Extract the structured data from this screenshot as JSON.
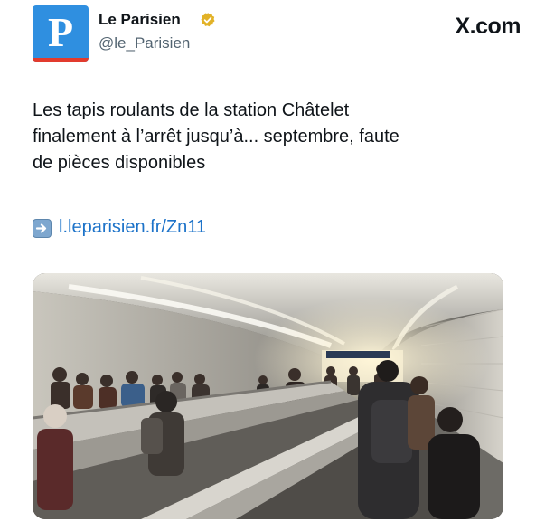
{
  "account": {
    "name": "Le Parisien",
    "handle": "@le_Parisien",
    "avatar_letter": "P",
    "verified_icon": "verified-badge-icon",
    "verified_color": "#e2b227"
  },
  "brand": {
    "label": "X.com"
  },
  "tweet": {
    "text_line1": "Les tapis roulants de la station Châtelet",
    "text_line2": "finalement à l’arrêt jusqu’à... septembre, faute",
    "text_line3": "de pièces disponibles",
    "link_icon": "right-arrow-icon",
    "link_text": "l.leparisien.fr/Zn11",
    "link_color": "#1d73c9"
  },
  "media": {
    "icon": "photo-subway-moving-walkway"
  }
}
